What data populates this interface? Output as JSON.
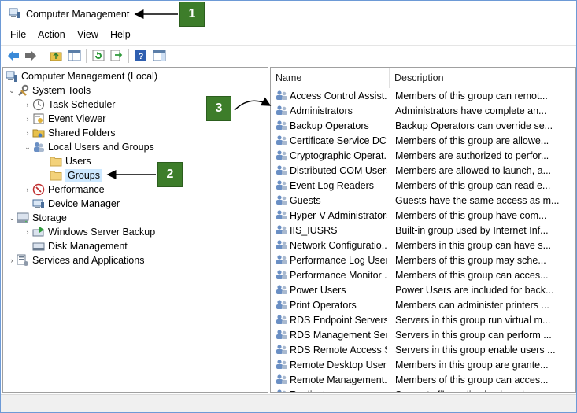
{
  "window": {
    "title": "Computer Management"
  },
  "menu": {
    "items": [
      "File",
      "Action",
      "View",
      "Help"
    ]
  },
  "toolbar": {
    "buttons": [
      "back-icon",
      "forward-icon",
      "up-folder-icon",
      "show-hide-tree-icon",
      "refresh-icon",
      "export-list-icon",
      "help-icon",
      "show-action-pane-icon"
    ]
  },
  "tree": {
    "root": "Computer Management (Local)",
    "system_tools": "System Tools",
    "task_scheduler": "Task Scheduler",
    "event_viewer": "Event Viewer",
    "shared_folders": "Shared Folders",
    "local_users_groups": "Local Users and Groups",
    "users": "Users",
    "groups": "Groups",
    "performance": "Performance",
    "device_manager": "Device Manager",
    "storage": "Storage",
    "windows_server_backup": "Windows Server Backup",
    "disk_management": "Disk Management",
    "services_apps": "Services and Applications"
  },
  "list": {
    "col_name": "Name",
    "col_desc": "Description",
    "rows": [
      {
        "name": "Access Control Assist...",
        "desc": "Members of this group can remot..."
      },
      {
        "name": "Administrators",
        "desc": "Administrators have complete an..."
      },
      {
        "name": "Backup Operators",
        "desc": "Backup Operators can override se..."
      },
      {
        "name": "Certificate Service DC...",
        "desc": "Members of this group are allowe..."
      },
      {
        "name": "Cryptographic Operat...",
        "desc": "Members are authorized to perfor..."
      },
      {
        "name": "Distributed COM Users",
        "desc": "Members are allowed to launch, a..."
      },
      {
        "name": "Event Log Readers",
        "desc": "Members of this group can read e..."
      },
      {
        "name": "Guests",
        "desc": "Guests have the same access as m..."
      },
      {
        "name": "Hyper-V Administrators",
        "desc": "Members of this group have com..."
      },
      {
        "name": "IIS_IUSRS",
        "desc": "Built-in group used by Internet Inf..."
      },
      {
        "name": "Network Configuratio...",
        "desc": "Members in this group can have s..."
      },
      {
        "name": "Performance Log Users",
        "desc": "Members of this group may sche..."
      },
      {
        "name": "Performance Monitor ...",
        "desc": "Members of this group can acces..."
      },
      {
        "name": "Power Users",
        "desc": "Power Users are included for back..."
      },
      {
        "name": "Print Operators",
        "desc": "Members can administer printers ..."
      },
      {
        "name": "RDS Endpoint Servers",
        "desc": "Servers in this group run virtual m..."
      },
      {
        "name": "RDS Management Ser...",
        "desc": "Servers in this group can perform ..."
      },
      {
        "name": "RDS Remote Access S...",
        "desc": "Servers in this group enable users ..."
      },
      {
        "name": "Remote Desktop Users",
        "desc": "Members in this group are grante..."
      },
      {
        "name": "Remote Management...",
        "desc": "Members of this group can acces..."
      },
      {
        "name": "Replicator",
        "desc": "Supports file replication in a dom..."
      }
    ]
  },
  "callouts": {
    "c1": "1",
    "c2": "2",
    "c3": "3"
  },
  "colors": {
    "callout_green": "#3d7d2a",
    "selection_blue": "#cce8ff"
  }
}
